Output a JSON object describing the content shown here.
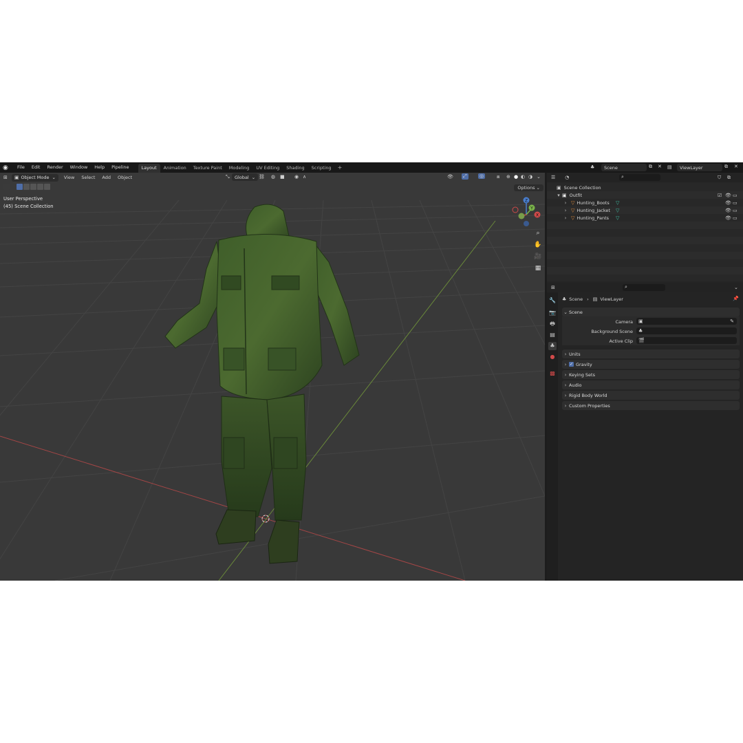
{
  "menu": {
    "items": [
      "File",
      "Edit",
      "Render",
      "Window",
      "Help",
      "Pipeline"
    ]
  },
  "workspaces": {
    "tabs": [
      "Layout",
      "Animation",
      "Texture Paint",
      "Modeling",
      "UV Editing",
      "Shading",
      "Scripting"
    ],
    "active": "Layout",
    "add": "+"
  },
  "top_right": {
    "scene_name": "Scene",
    "view_layer": "ViewLayer"
  },
  "viewport": {
    "mode": "Object Mode",
    "menus": [
      "View",
      "Select",
      "Add",
      "Object"
    ],
    "transform_orientation": "Global",
    "perspective_label": "User Perspective",
    "collection_label": "(45) Scene Collection",
    "options_label": "Options",
    "gizmo": {
      "z": "Z",
      "y": "Y",
      "x": "X"
    }
  },
  "outliner": {
    "root": "Scene Collection",
    "collection": "Outfit",
    "objects": [
      "Hunting_Boots",
      "Hunting_Jacket",
      "Hunting_Pants"
    ]
  },
  "properties": {
    "breadcrumb_scene": "Scene",
    "breadcrumb_layer": "ViewLayer",
    "scene_panel": {
      "title": "Scene",
      "fields": [
        {
          "label": "Camera"
        },
        {
          "label": "Background Scene"
        },
        {
          "label": "Active Clip"
        }
      ]
    },
    "collapsed_panels": [
      "Units",
      "Gravity",
      "Keying Sets",
      "Audio",
      "Rigid Body World",
      "Custom Properties"
    ]
  },
  "colors": {
    "accent_active": "#4f6ea8",
    "object_icon": "#e08a3a",
    "modifier_icon": "#3fc3a8",
    "axis_x": "#d04a4a",
    "axis_y": "#7ab44a",
    "axis_z": "#4a7fd0"
  }
}
